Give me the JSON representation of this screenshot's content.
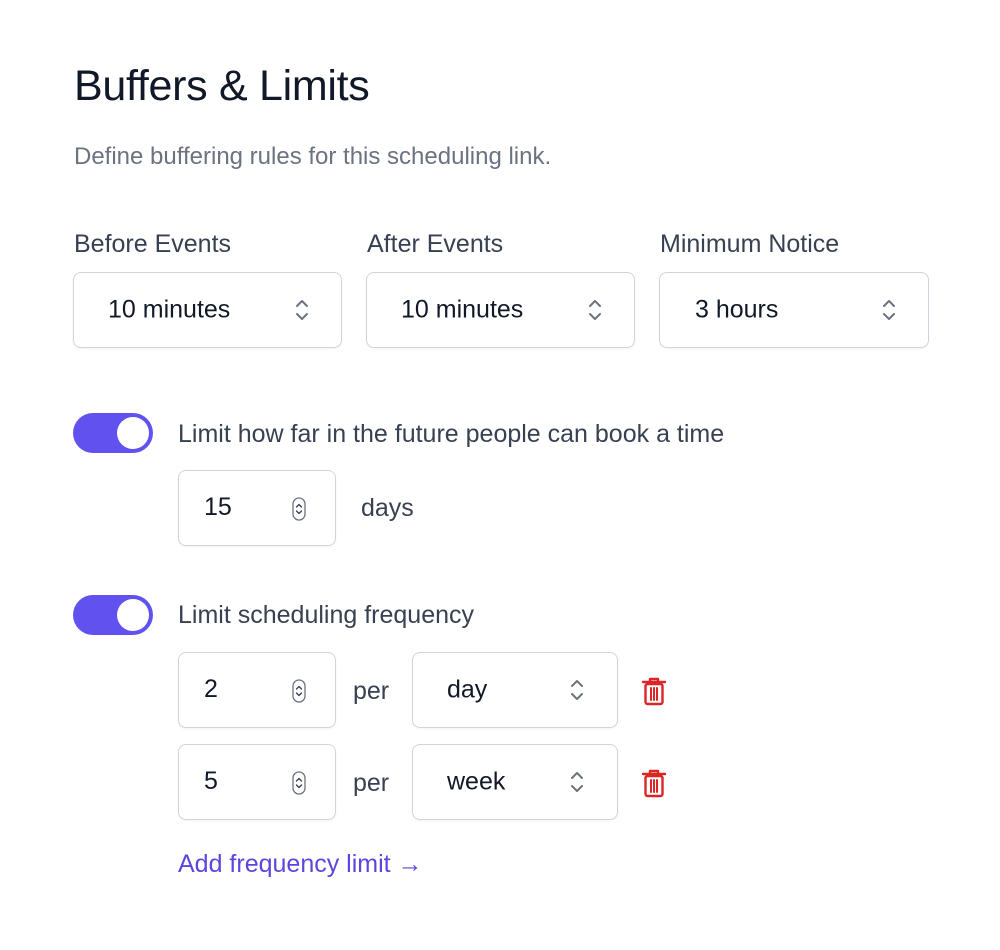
{
  "header": {
    "title": "Buffers & Limits",
    "subtitle": "Define buffering rules for this scheduling link."
  },
  "buffers": {
    "before": {
      "label": "Before Events",
      "value": "10 minutes"
    },
    "after": {
      "label": "After Events",
      "value": "10 minutes"
    },
    "notice": {
      "label": "Minimum Notice",
      "value": "3 hours"
    }
  },
  "future_limit": {
    "enabled": true,
    "label": "Limit how far in the future people can book a time",
    "value": "15",
    "unit": "days"
  },
  "frequency": {
    "enabled": true,
    "label": "Limit scheduling frequency",
    "per_label": "per",
    "rows": [
      {
        "count": "2",
        "period": "day"
      },
      {
        "count": "5",
        "period": "week"
      }
    ],
    "add_link": "Add frequency limit →"
  },
  "colors": {
    "accent": "#6152f0",
    "link": "#5b47e0",
    "danger": "#dc2626",
    "border": "#d1d5db"
  },
  "icons": {
    "select_chevron": "chevron-up-down-icon",
    "number_spinner": "spinner-icon",
    "delete": "trash-icon"
  }
}
